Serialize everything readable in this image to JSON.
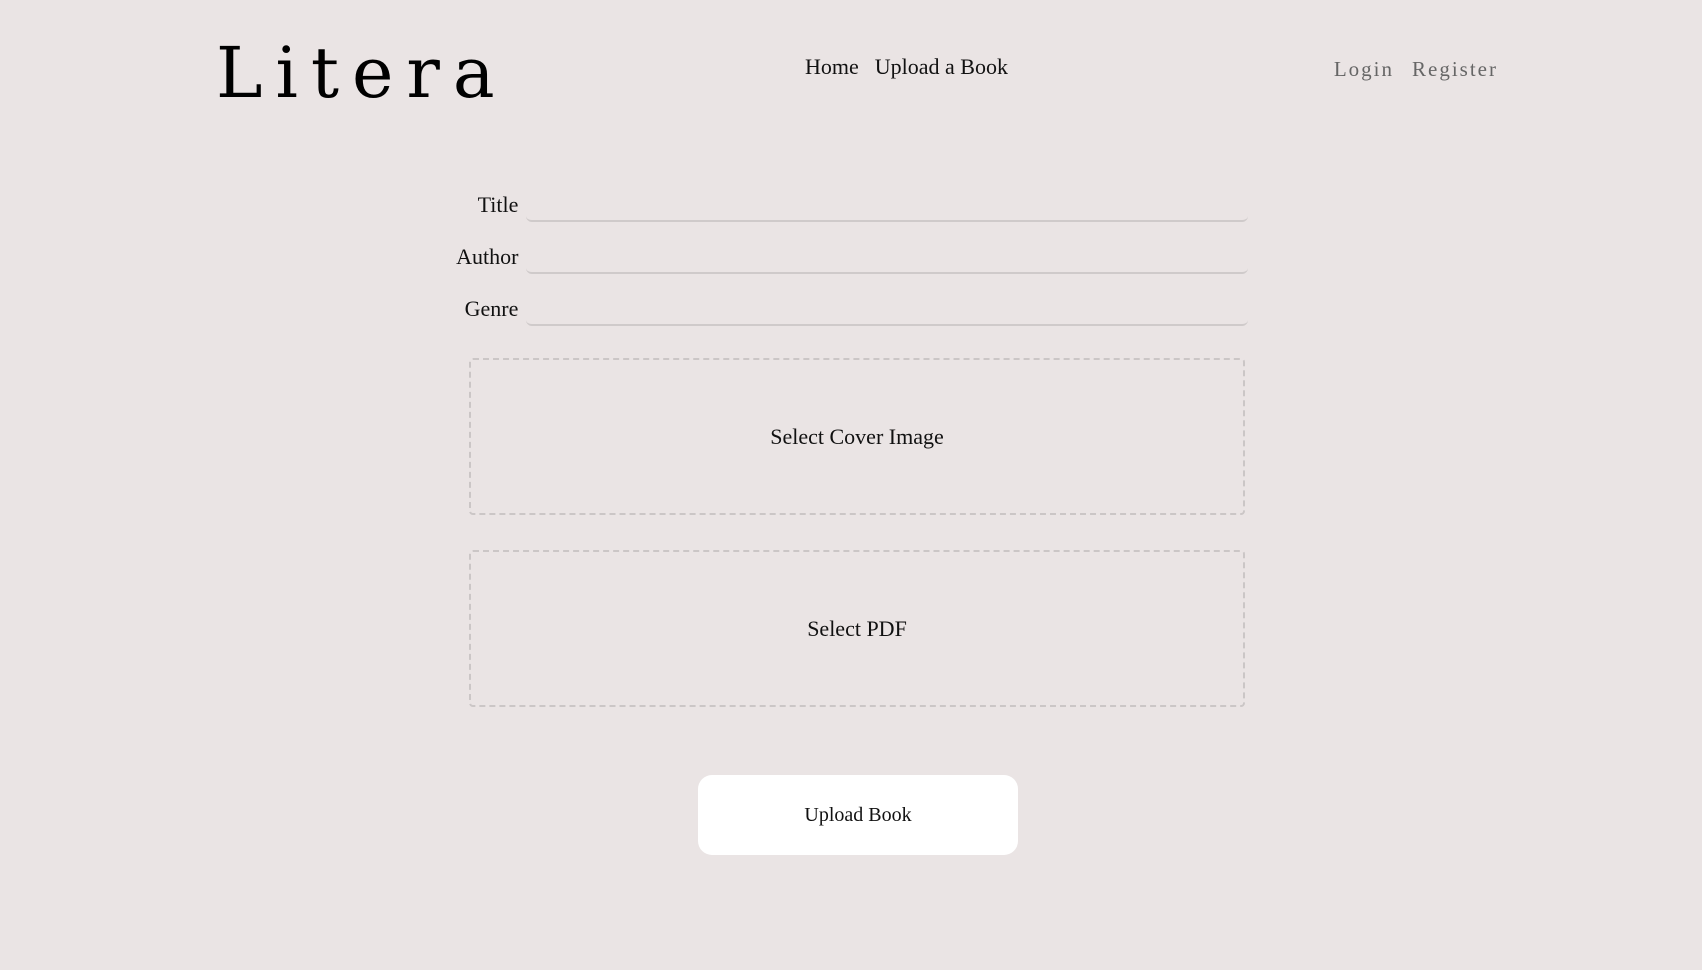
{
  "header": {
    "logo": "Litera",
    "nav": {
      "home": "Home",
      "upload": "Upload a Book"
    },
    "auth": {
      "login": "Login",
      "register": "Register"
    }
  },
  "form": {
    "fields": [
      {
        "label": "Title",
        "value": ""
      },
      {
        "label": "Author",
        "value": ""
      },
      {
        "label": "Genre",
        "value": ""
      }
    ],
    "cover_label": "Select Cover Image",
    "pdf_label": "Select PDF",
    "submit_label": "Upload Book"
  },
  "colors": {
    "background": "#eae4e4",
    "button_background": "#ffffff",
    "muted_text": "#666666",
    "dashed_border": "#cbc6c6"
  }
}
